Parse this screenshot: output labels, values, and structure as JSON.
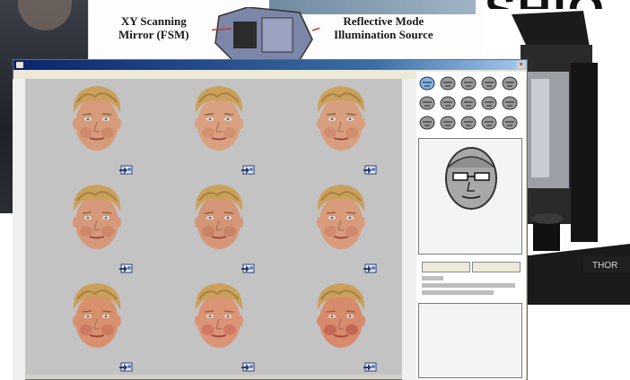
{
  "window": {
    "title": "",
    "menu": "",
    "close_glyph": "×"
  },
  "background": {
    "diagram_label_left_line1": "XY Scanning",
    "diagram_label_left_line2": "Mirror (FSM)",
    "diagram_label_right_line1": "Reflective Mode",
    "diagram_label_right_line2": "Illumination Source",
    "headline_fragment": "SHIO",
    "machine_brand": "THOR"
  },
  "faces": [
    {
      "row": 0,
      "col": 0,
      "skin": "#d69b7a",
      "cheek": "#c98266"
    },
    {
      "row": 0,
      "col": 1,
      "skin": "#d9a180",
      "cheek": "#cc8a6d"
    },
    {
      "row": 0,
      "col": 2,
      "skin": "#d89f7e",
      "cheek": "#ca866a"
    },
    {
      "row": 1,
      "col": 0,
      "skin": "#d6987a",
      "cheek": "#c98064"
    },
    {
      "row": 1,
      "col": 1,
      "skin": "#d59677",
      "cheek": "#c27a60"
    },
    {
      "row": 1,
      "col": 2,
      "skin": "#d89c7c",
      "cheek": "#c98368"
    },
    {
      "row": 2,
      "col": 0,
      "skin": "#d8906f",
      "cheek": "#c8705a"
    },
    {
      "row": 2,
      "col": 1,
      "skin": "#dc9476",
      "cheek": "#cc6e5e"
    },
    {
      "row": 2,
      "col": 2,
      "skin": "#d88a6c",
      "cheek": "#b95a4a"
    }
  ],
  "side_panel": {
    "tool_icons": [
      "face-shape-icon",
      "hair-icon",
      "eyes-icon",
      "brows-icon",
      "nose-icon",
      "mouth-icon",
      "ears-icon",
      "jaw-icon",
      "cheeks-icon",
      "chin-icon",
      "glasses-icon",
      "beard-icon",
      "hat-icon",
      "skin-icon",
      "age-icon"
    ],
    "button_left": "",
    "button_right": ""
  },
  "colors": {
    "titlebar": "#0a246a",
    "grid_bg": "#c3c3c3",
    "hair": "#c9a15c"
  }
}
